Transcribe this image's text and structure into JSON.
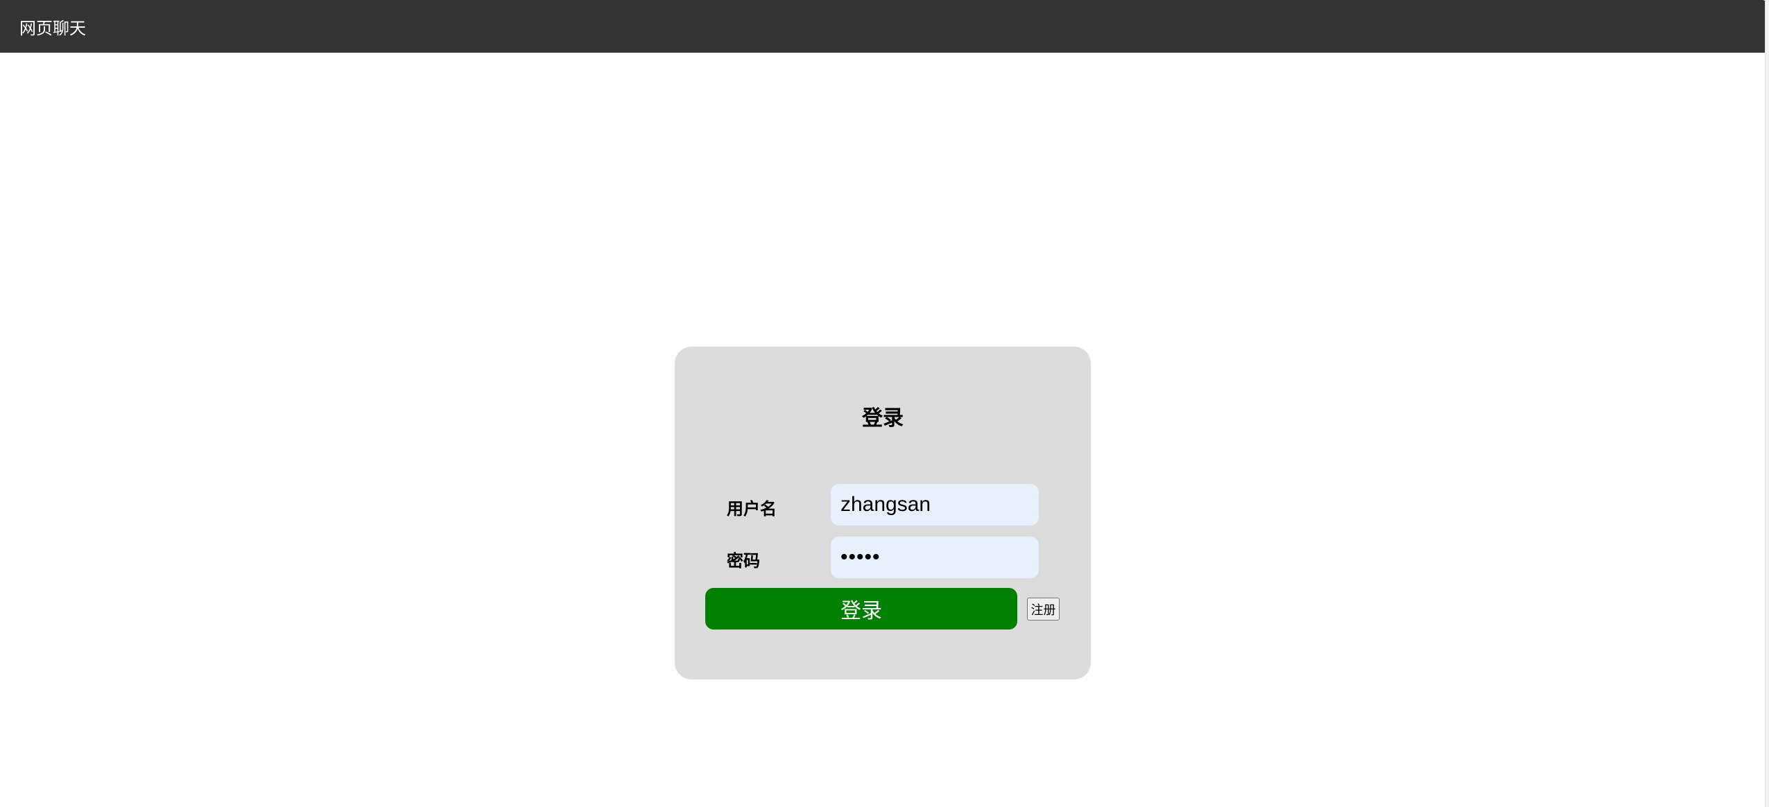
{
  "header": {
    "title": "网页聊天"
  },
  "login_form": {
    "title": "登录",
    "username_label": "用户名",
    "username_value": "zhangsan",
    "password_label": "密码",
    "password_value": "12345",
    "login_label": "登录",
    "register_label": "注册"
  },
  "colors": {
    "nav_background": "#333333",
    "card_background": "#dcdcdc",
    "input_background": "#e8f0fe",
    "login_button": "#008000"
  }
}
